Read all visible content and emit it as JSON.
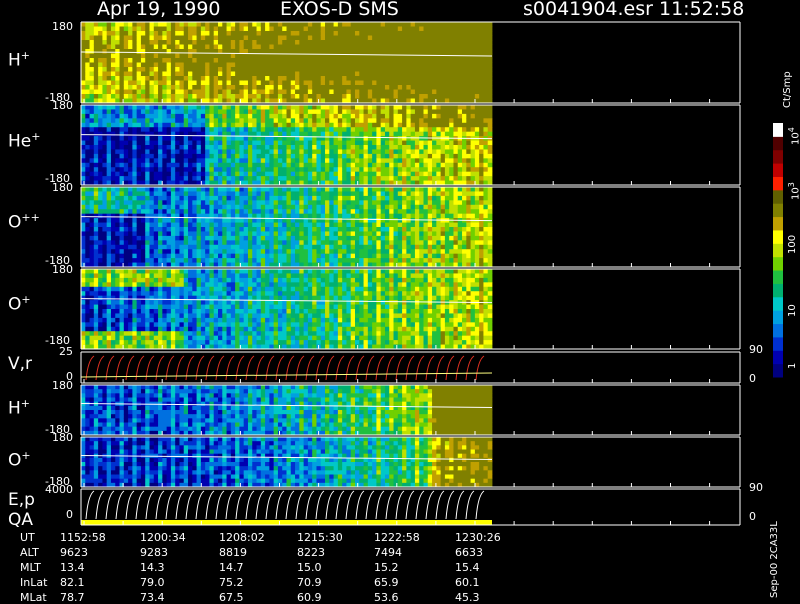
{
  "header": {
    "date": "Apr 19, 1990",
    "instrument": "EXOS-D SMS",
    "file": "s0041904.esr",
    "time": "11:52:58"
  },
  "panels": [
    {
      "label": "H",
      "sup": "+",
      "ymax": "180",
      "ymin": "-180"
    },
    {
      "label": "He",
      "sup": "+",
      "ymax": "180",
      "ymin": "-180"
    },
    {
      "label": "O",
      "sup": "++",
      "ymax": "180",
      "ymin": "-180"
    },
    {
      "label": "O",
      "sup": "+",
      "ymax": "180",
      "ymin": "-180"
    },
    {
      "label": "V,r",
      "sup": "",
      "ymax": "25",
      "ymin": "0",
      "rmax": "90",
      "rmin": "0"
    },
    {
      "label": "H",
      "sup": "+",
      "ymax": "180",
      "ymin": "-180"
    },
    {
      "label": "O",
      "sup": "+",
      "ymax": "180",
      "ymin": "-180"
    },
    {
      "label": "E,p",
      "label2": "QA",
      "sup": "",
      "ymax": "4000",
      "ymin": "0",
      "rmax": "90",
      "rmin": "0"
    }
  ],
  "colorbar": {
    "unit": "Ct/Smp",
    "ticks": [
      "1",
      "10",
      "100",
      "10",
      "10"
    ],
    "tick_sups": [
      "",
      "",
      "",
      "3",
      "4"
    ],
    "colors": [
      "#000080",
      "#0000b0",
      "#0030d0",
      "#0070e0",
      "#00a0e0",
      "#00c8c8",
      "#00b070",
      "#20c040",
      "#70d000",
      "#c0e000",
      "#ffff00",
      "#c0a000",
      "#808000",
      "#606000",
      "#ff2000",
      "#c00000",
      "#800000",
      "#500000",
      "#ffffff"
    ]
  },
  "footer": {
    "rows": [
      {
        "name": "UT",
        "values": [
          "1152:58",
          "1200:34",
          "1208:02",
          "1215:30",
          "1222:58",
          "1230:26"
        ]
      },
      {
        "name": "ALT",
        "values": [
          "9623",
          "9283",
          "8819",
          "8223",
          "7494",
          "6633"
        ]
      },
      {
        "name": "MLT",
        "values": [
          "13.4",
          "14.3",
          "14.7",
          "15.0",
          "15.2",
          "15.4"
        ]
      },
      {
        "name": "InLat",
        "values": [
          "82.1",
          "79.0",
          "75.2",
          "70.9",
          "65.9",
          "60.1"
        ]
      },
      {
        "name": "MLat",
        "values": [
          "78.7",
          "73.4",
          "67.5",
          "60.9",
          "53.6",
          "45.3"
        ]
      }
    ],
    "side_label": "Sep-00 2CA33L"
  },
  "chart_data": {
    "type": "heatmap",
    "title": "Apr 19, 1990 EXOS-D SMS",
    "x_ticks": [
      "1152:58",
      "1200:34",
      "1208:02",
      "1215:30",
      "1222:58",
      "1230:26"
    ],
    "data_extent_to": "1230:26",
    "colorscale": "log",
    "color_range": [
      1,
      10000
    ],
    "color_unit": "Ct/Smp",
    "series": [
      {
        "name": "H+",
        "ylim": [
          -180,
          180
        ]
      },
      {
        "name": "He+",
        "ylim": [
          -180,
          180
        ]
      },
      {
        "name": "O++",
        "ylim": [
          -180,
          180
        ]
      },
      {
        "name": "O+",
        "ylim": [
          -180,
          180
        ]
      },
      {
        "name": "V,r",
        "ylim": [
          0,
          25
        ]
      },
      {
        "name": "H+",
        "ylim": [
          -180,
          180
        ]
      },
      {
        "name": "O+",
        "ylim": [
          -180,
          180
        ]
      },
      {
        "name": "E,p QA",
        "ylim": [
          0,
          4000
        ]
      }
    ]
  }
}
